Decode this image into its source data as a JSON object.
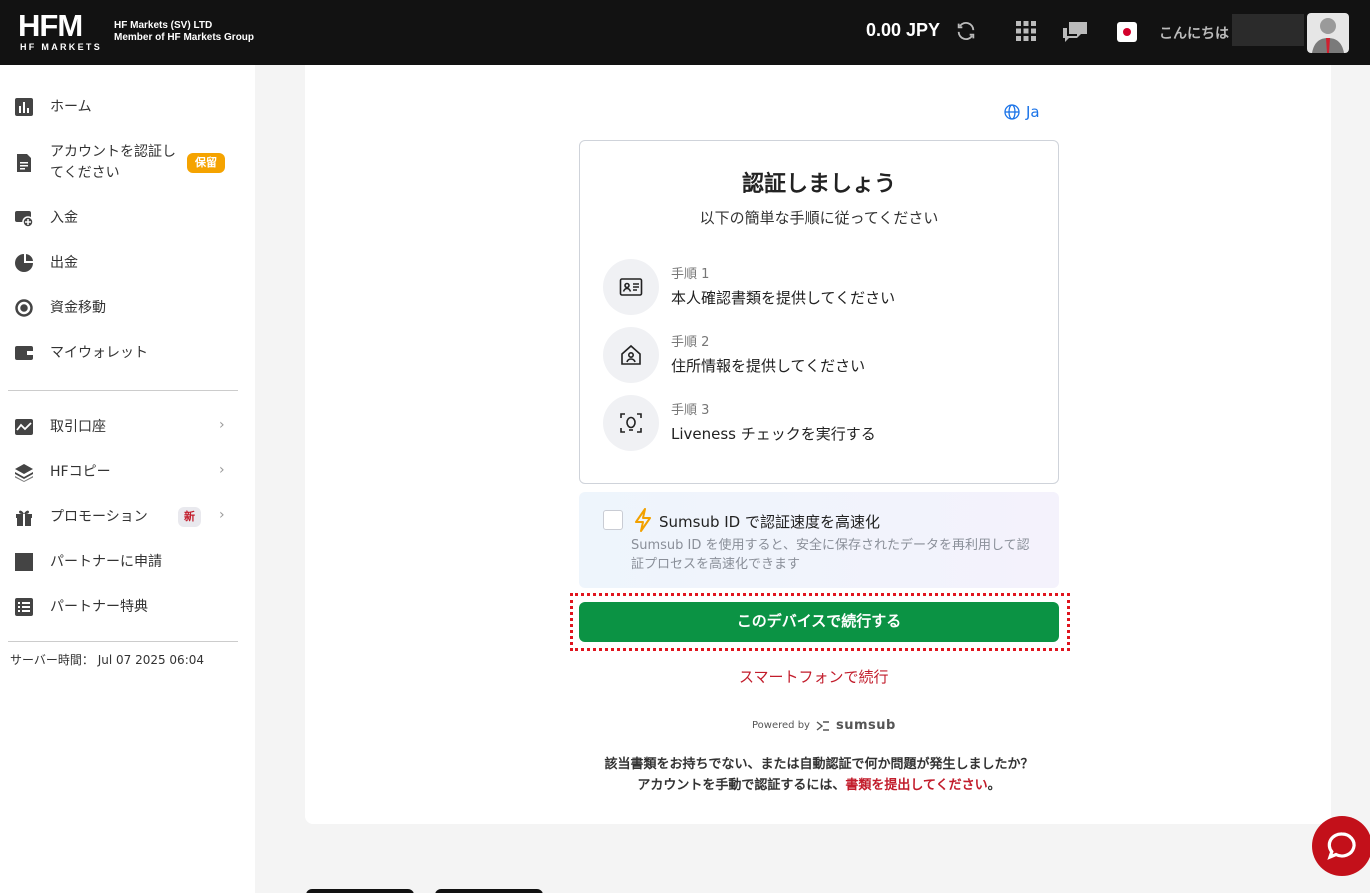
{
  "header": {
    "logo_text": "HFM",
    "logo_sub": "HF MARKETS",
    "company_line1": "HF Markets (SV) LTD",
    "company_line2": "Member of HF Markets Group",
    "balance": "0.00 JPY",
    "greeting": "こんにちは",
    "icons": [
      "refresh-icon",
      "apps-grid-icon",
      "chat-icon",
      "japan-flag-icon",
      "avatar"
    ]
  },
  "sidebar": {
    "items": [
      {
        "label": "ホーム",
        "icon": "chart-icon"
      },
      {
        "label": "アカウントを認証し",
        "label2": "てください",
        "badge": "保留",
        "icon": "document-icon"
      },
      {
        "label": "入金",
        "icon": "deposit-icon"
      },
      {
        "label": "出金",
        "icon": "withdraw-icon"
      },
      {
        "label": "資金移動",
        "icon": "transfer-icon"
      },
      {
        "label": "マイウォレット",
        "icon": "wallet-icon"
      },
      {
        "label": "取引口座",
        "icon": "trading-icon"
      },
      {
        "label": "HFコピー",
        "icon": "layers-icon"
      },
      {
        "label": "プロモーション",
        "badge": "新",
        "icon": "gift-icon"
      },
      {
        "label": "パートナーに申請",
        "icon": "partner-icon"
      },
      {
        "label": "パートナー特典",
        "icon": "list-icon"
      }
    ],
    "server_time": "サーバー時間： Jul 07 2025 06:04"
  },
  "main": {
    "lang": "Ja",
    "title": "認証しましょう",
    "subtitle": "以下の簡単な手順に従ってください",
    "steps": [
      {
        "num": "手順 1",
        "text": "本人確認書類を提供してください"
      },
      {
        "num": "手順 2",
        "text": "住所情報を提供してください"
      },
      {
        "num": "手順 3",
        "text": "Liveness チェックを実行する"
      }
    ],
    "sumsub_title": "Sumsub ID で認証速度を高速化",
    "sumsub_desc": "Sumsub ID を使用すると、安全に保存されたデータを再利用して認証プロセスを高速化できます",
    "continue_button": "このデバイスで続行する",
    "phone_link": "スマートフォンで続行",
    "powered_by": "Powered by",
    "powered_brand": "sumsub",
    "help_line1": "該当書類をお持ちでない、または自動認証で何か問題が発生しましたか？",
    "help_line2_prefix": "アカウントを手動で認証するには、",
    "help_line2_link": "書類を提出してください",
    "help_line2_suffix": "。"
  },
  "colors": {
    "header_bg": "#121212",
    "brand_red": "#c21c2b",
    "button_green": "#0b9344",
    "badge_orange": "#f5a300",
    "link_blue": "#1a73e8"
  }
}
